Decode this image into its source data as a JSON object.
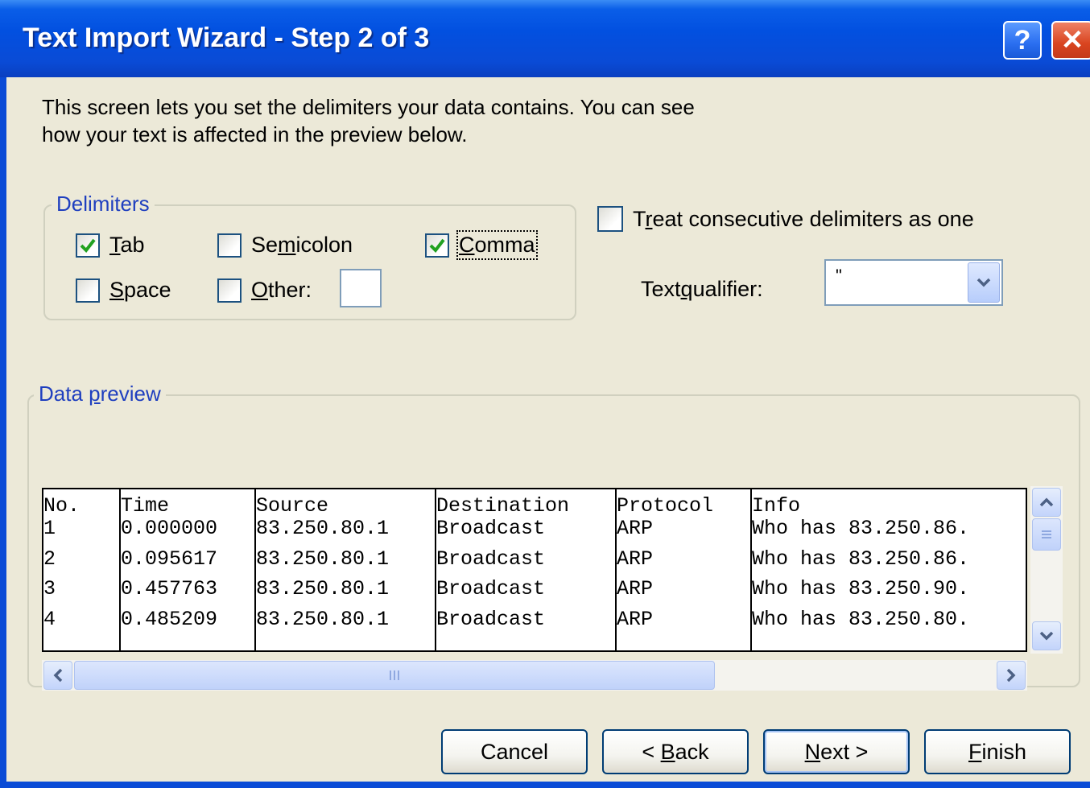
{
  "window": {
    "title": "Text Import Wizard - Step 2 of 3",
    "help_glyph": "?",
    "close_glyph": "✕"
  },
  "intro": {
    "line1": "This screen lets you set the delimiters your data contains.  You can see",
    "line2": "how your text is affected in the preview below."
  },
  "delimiters": {
    "group_label": "Delimiters",
    "tab": {
      "pre": "",
      "u": "T",
      "post": "ab",
      "checked": true
    },
    "semicolon": {
      "pre": "Se",
      "u": "m",
      "post": "icolon",
      "checked": false
    },
    "comma": {
      "pre": "",
      "u": "C",
      "post": "omma",
      "checked": true
    },
    "space": {
      "pre": "",
      "u": "S",
      "post": "pace",
      "checked": false
    },
    "other": {
      "pre": "",
      "u": "O",
      "post": "ther:",
      "checked": false,
      "value": ""
    }
  },
  "treat_consecutive": {
    "pre": "T",
    "u": "r",
    "post": "eat consecutive delimiters as one",
    "checked": false
  },
  "text_qualifier": {
    "pre": "Text ",
    "u": "q",
    "post": "ualifier:",
    "value": "\""
  },
  "preview": {
    "group_label_pre": "Data ",
    "group_label_u": "p",
    "group_label_post": "review",
    "columns": [
      {
        "cells": [
          "No.",
          "1",
          "2",
          "3",
          "4"
        ]
      },
      {
        "cells": [
          "Time",
          "0.000000",
          "0.095617",
          "0.457763",
          "0.485209"
        ]
      },
      {
        "cells": [
          "Source",
          "83.250.80.1",
          "83.250.80.1",
          "83.250.80.1",
          "83.250.80.1"
        ]
      },
      {
        "cells": [
          "Destination",
          "Broadcast",
          "Broadcast",
          "Broadcast",
          "Broadcast"
        ]
      },
      {
        "cells": [
          "Protocol",
          "ARP",
          "ARP",
          "ARP",
          "ARP"
        ]
      },
      {
        "cells": [
          "Info",
          "Who has 83.250.86.",
          "Who has 83.250.86.",
          "Who has 83.250.90.",
          "Who has 83.250.80."
        ]
      }
    ]
  },
  "buttons": {
    "cancel": {
      "pre": "Cancel",
      "u": "",
      "post": ""
    },
    "back": {
      "pre": "< ",
      "u": "B",
      "post": "ack"
    },
    "next": {
      "pre": "",
      "u": "N",
      "post": "ext >"
    },
    "finish": {
      "pre": "",
      "u": "F",
      "post": "inish"
    }
  },
  "colors": {
    "title_bar": "#0a4bd6",
    "dialog_bg": "#ece9d8",
    "check_mark": "#21a121",
    "group_label": "#1f3fbf"
  }
}
